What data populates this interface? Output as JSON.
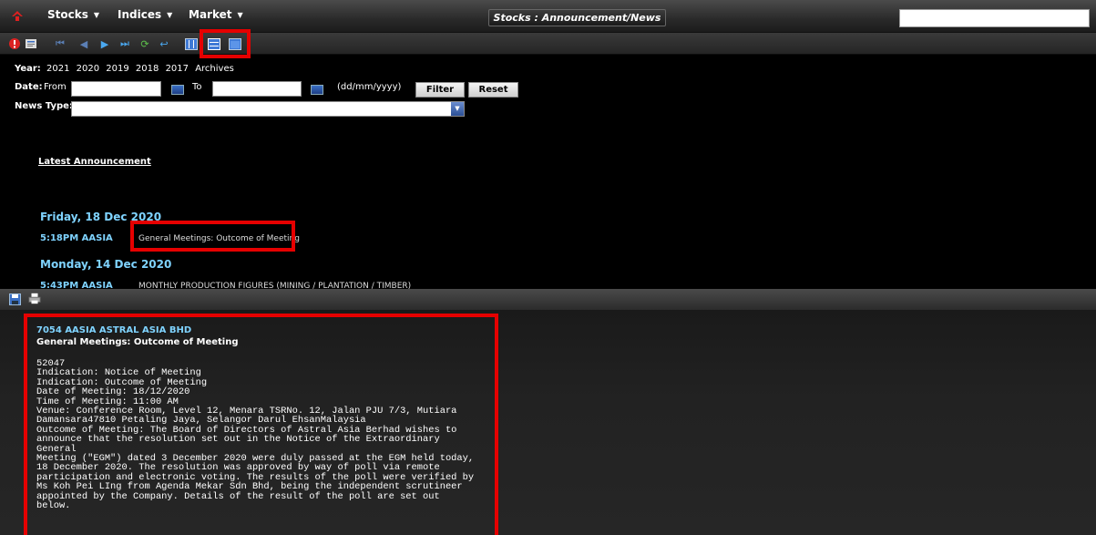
{
  "topbar": {
    "menu": [
      {
        "label": "Stocks"
      },
      {
        "label": "Indices"
      },
      {
        "label": "Market"
      }
    ],
    "title": "Stocks : Announcement/News",
    "search_value": ""
  },
  "filters": {
    "year_label": "Year:",
    "years": [
      "2021",
      "2020",
      "2019",
      "2018",
      "2017",
      "Archives"
    ],
    "date_label": "Date:",
    "from_label": "From",
    "to_label": "To",
    "date_hint": "(dd/mm/yyyy)",
    "from_value": "",
    "to_value": "",
    "filter_button": "Filter",
    "reset_button": "Reset",
    "news_type_label": "News Type:",
    "news_type_value": ""
  },
  "list": {
    "heading": "Latest Announcement",
    "groups": [
      {
        "date": "Friday, 18 Dec 2020",
        "items": [
          {
            "time_code": "5:18PM  AASIA",
            "title": "General Meetings: Outcome of Meeting"
          }
        ]
      },
      {
        "date": "Monday, 14 Dec 2020",
        "items": [
          {
            "time_code": "5:43PM  AASIA",
            "title": "MONTHLY PRODUCTION FIGURES (MINING / PLANTATION / TIMBER)"
          }
        ]
      }
    ]
  },
  "detail": {
    "header": "7054   AASIA   ASTRAL ASIA BHD",
    "subject": "General Meetings: Outcome of Meeting",
    "body": "52047\nIndication: Notice of Meeting\nIndication: Outcome of Meeting\nDate of Meeting: 18/12/2020\nTime of Meeting: 11:00 AM\nVenue: Conference Room, Level 12, Menara TSRNo. 12, Jalan PJU 7/3, Mutiara\nDamansara47810 Petaling Jaya, Selangor Darul EhsanMalaysia\nOutcome of Meeting: The Board of Directors of Astral Asia Berhad wishes to\nannounce that the resolution set out in the Notice of the Extraordinary General\nMeeting (\"EGM\") dated 3 December 2020 were duly passed at the EGM held today,\n18 December 2020. The resolution was approved by way of poll via remote\nparticipation and electronic voting. The results of the poll were verified by\nMs Koh Pei LIng from Agenda Mekar Sdn Bhd, being the independent scrutineer\nappointed by the Company. Details of the result of the poll are set out\nbelow."
  },
  "colors": {
    "accent_cyan": "#7fd3ff",
    "highlight_red": "#e60000",
    "background": "#000000"
  },
  "icons": {
    "toolbar": [
      "alert-icon",
      "news-icon",
      "first-icon",
      "prev-icon",
      "next-icon",
      "last-icon",
      "refresh-icon",
      "back-icon",
      "layout-columns-icon",
      "layout-rows-icon",
      "layout-single-icon"
    ],
    "toolbar2": [
      "save-icon",
      "print-icon"
    ]
  }
}
